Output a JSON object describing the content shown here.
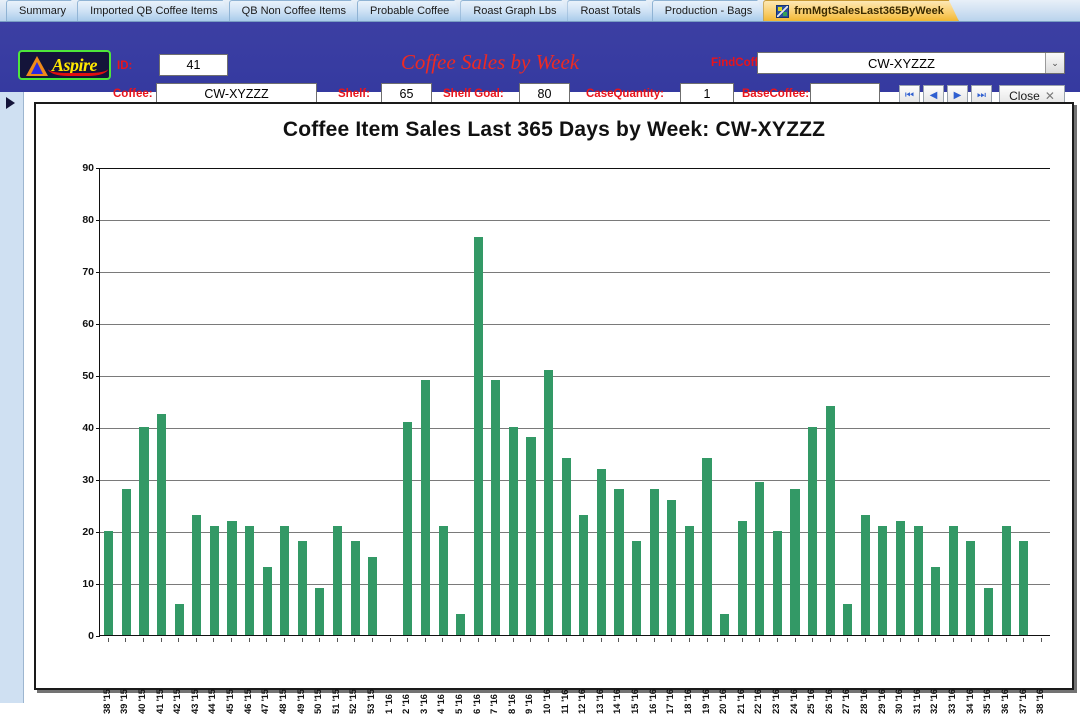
{
  "tabs": [
    {
      "label": "Summary",
      "active": false,
      "icon": null
    },
    {
      "label": "Imported QB Coffee Items",
      "active": false,
      "icon": null
    },
    {
      "label": "QB Non Coffee Items",
      "active": false,
      "icon": null
    },
    {
      "label": "Probable Coffee",
      "active": false,
      "icon": null
    },
    {
      "label": "Roast Graph Lbs",
      "active": false,
      "icon": null
    },
    {
      "label": "Roast Totals",
      "active": false,
      "icon": null
    },
    {
      "label": "Production - Bags",
      "active": false,
      "icon": null
    },
    {
      "label": "frmMgtSalesLast365ByWeek",
      "active": true,
      "icon": "form-icon"
    }
  ],
  "form": {
    "title": "Coffee Sales by Week",
    "logo_text": "Aspire",
    "fields": [
      {
        "label": "ID:",
        "value": "41"
      },
      {
        "label": "Coffee:",
        "value": "CW-XYZZZ"
      },
      {
        "label": "Shelf:",
        "value": "65"
      },
      {
        "label": "Shelf Goal:",
        "value": "80"
      },
      {
        "label": "CaseQuantity:",
        "value": "1"
      },
      {
        "label": "BaseCoffee:",
        "value": ""
      }
    ],
    "find_label": "FindCoffee:",
    "find_value": "CW-XYZZZ",
    "nav_buttons": [
      "first-record",
      "previous-record",
      "next-record",
      "last-record"
    ],
    "close_label": "Close",
    "close_glyph": "✕",
    "dropdown_glyph": "⌄",
    "nav_glyphs": [
      "⏮",
      "◀",
      "▶",
      "⏭"
    ]
  },
  "colors": {
    "bar": "#339966",
    "header_bg": "#3b3fa0",
    "label_red": "#e8141c",
    "title_red": "#ee2a22",
    "tab_active": "#f9cd6a"
  },
  "chart_data": {
    "type": "bar",
    "title": "Coffee Item Sales Last 365 Days by Week:  CW-XYZZZ",
    "xlabel": "",
    "ylabel": "",
    "ylim": [
      0,
      90
    ],
    "yticks": [
      0,
      10,
      20,
      30,
      40,
      50,
      60,
      70,
      80,
      90
    ],
    "grid": true,
    "legend": false,
    "categories": [
      "38 '15",
      "39 '15",
      "40 '15",
      "41 '15",
      "42 '15",
      "43 '15",
      "44 '15",
      "45 '15",
      "46 '15",
      "47 '15",
      "48 '15",
      "49 '15",
      "50 '15",
      "51 '15",
      "52 '15",
      "53 '15",
      "1 '16",
      "2 '16",
      "3 '16",
      "4 '16",
      "5 '16",
      "6 '16",
      "7 '16",
      "8 '16",
      "9 '16",
      "10 '16",
      "11 '16",
      "12 '16",
      "13 '16",
      "14 '16",
      "15 '16",
      "16 '16",
      "17 '16",
      "18 '16",
      "19 '16",
      "20 '16",
      "21 '16",
      "22 '16",
      "23 '16",
      "24 '16",
      "25 '16",
      "26 '16",
      "27 '16",
      "28 '16",
      "29 '16",
      "30 '16",
      "31 '16",
      "32 '16",
      "33 '16",
      "34 '16",
      "35 '16",
      "36 '16",
      "37 '16",
      "38 '16"
    ],
    "values": [
      20,
      28,
      40,
      42.5,
      6,
      23,
      21,
      22,
      21,
      13,
      21,
      18,
      9,
      21,
      18,
      15,
      0,
      41,
      49,
      21,
      4,
      76.5,
      49,
      40,
      38,
      51,
      34,
      23,
      32,
      28,
      18,
      28,
      26,
      21,
      34,
      4,
      22,
      29.5,
      20,
      28,
      40,
      44,
      6,
      23,
      21,
      22,
      21,
      13,
      21,
      18,
      9,
      21,
      18,
      0
    ]
  }
}
